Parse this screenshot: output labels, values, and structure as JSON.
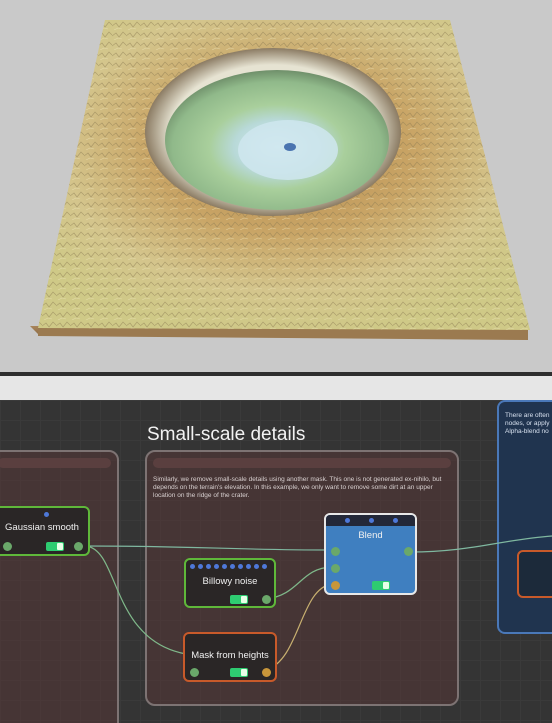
{
  "viewport": {
    "scene": "terrain-crater-render",
    "colors": {
      "background": "#c9c9c9",
      "terrain_base": "#cdbb7e",
      "crater": "#9fc496",
      "water": "#c8e2ec"
    }
  },
  "graph": {
    "colors": {
      "background": "#343434",
      "frame_border": "#7d7373",
      "green_node": "#5fb83a",
      "orange_node": "#c85a2a",
      "selected_node": "#e8e8e8",
      "blend_body": "#3f7fc0"
    },
    "frames": {
      "small_scale": {
        "title": "Small-scale details",
        "description": "Similarly, we remove small-scale details using another mask. This one is not generated ex-nihilo, but depends on the terrain's elevation. In this example, we only want to remove some dirt at an upper location on the ridge of the crater."
      },
      "right_note": {
        "description": "There are often nodes, or apply Alpha-blend no"
      }
    },
    "nodes": {
      "gaussian_smooth": {
        "label": "Gaussian smooth",
        "icon": "toggle-on"
      },
      "billowy_noise": {
        "label": "Billowy noise",
        "icon": "toggle-on"
      },
      "mask_from_heights": {
        "label": "Mask from heights",
        "icon": "toggle-on"
      },
      "blend": {
        "label": "Blend",
        "icon": "toggle-on"
      }
    }
  }
}
